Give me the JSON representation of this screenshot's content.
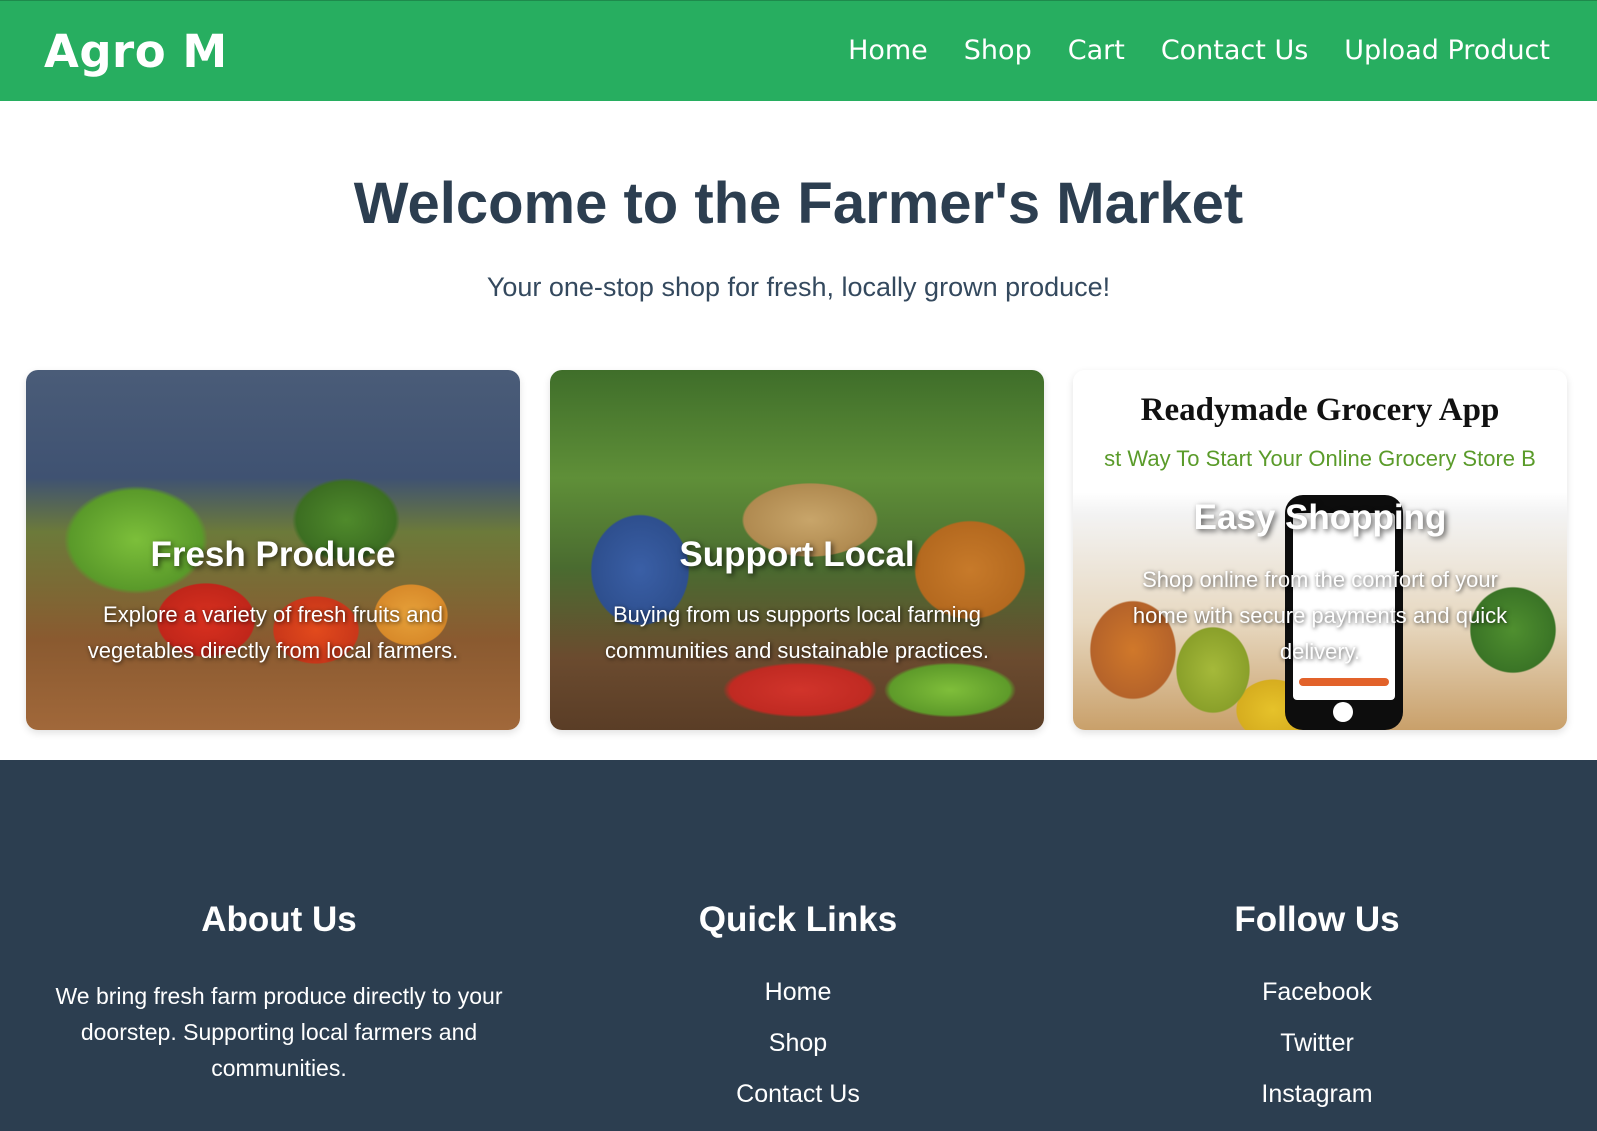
{
  "navbar": {
    "brand": "Agro M",
    "links": [
      "Home",
      "Shop",
      "Cart",
      "Contact Us",
      "Upload Product"
    ],
    "background": "#27ae60"
  },
  "hero": {
    "title": "Welcome to the Farmer's Market",
    "subtitle": "Your one-stop shop for fresh, locally grown produce!"
  },
  "cards": [
    {
      "title": "Fresh Produce",
      "text": "Explore a variety of fresh fruits and vegetables directly from local farmers."
    },
    {
      "title": "Support Local",
      "text": "Buying from us supports local farming communities and sustainable practices."
    },
    {
      "title": "Easy Shopping",
      "text": "Shop online from the comfort of your home with secure payments and quick delivery.",
      "image_heading": "Readymade Grocery App",
      "image_subheading": "st Way To Start Your Online Grocery Store B"
    }
  ],
  "footer": {
    "background": "#2c3e50",
    "about": {
      "heading": "About Us",
      "text": "We bring fresh farm produce directly to your doorstep. Supporting local farmers and communities."
    },
    "quick_links": {
      "heading": "Quick Links",
      "items": [
        "Home",
        "Shop",
        "Contact Us"
      ]
    },
    "follow": {
      "heading": "Follow Us",
      "items": [
        "Facebook",
        "Twitter",
        "Instagram"
      ]
    }
  }
}
